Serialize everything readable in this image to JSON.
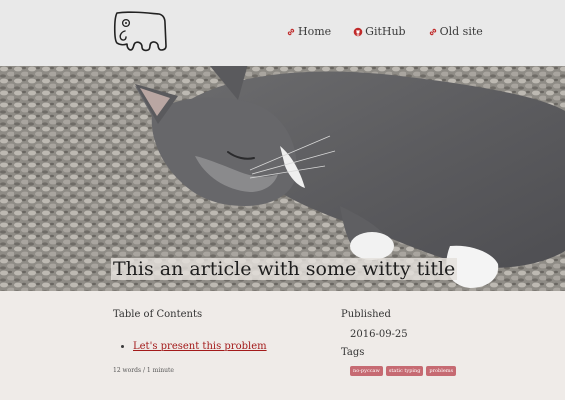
{
  "nav": {
    "items": [
      {
        "label": "Home",
        "icon": "link-icon"
      },
      {
        "label": "GitHub",
        "icon": "github-icon"
      },
      {
        "label": "Old site",
        "icon": "link-icon"
      }
    ]
  },
  "hero": {
    "title": "This an article with some witty title",
    "image": "sleeping-gray-cat-on-carpet"
  },
  "toc": {
    "heading": "Table of Contents",
    "items": [
      "Let's present this problem"
    ]
  },
  "meta": {
    "word_count": "12 words / 1 minute",
    "published_heading": "Published",
    "published_date": "2016-09-25",
    "tags_heading": "Tags",
    "tags": [
      "no-pyccaw",
      "static typing",
      "problems"
    ]
  },
  "colors": {
    "header_bg": "#e9e9e9",
    "page_bg": "#efebe8",
    "link": "#a31a1a",
    "tag_bg": "#c66a72"
  }
}
